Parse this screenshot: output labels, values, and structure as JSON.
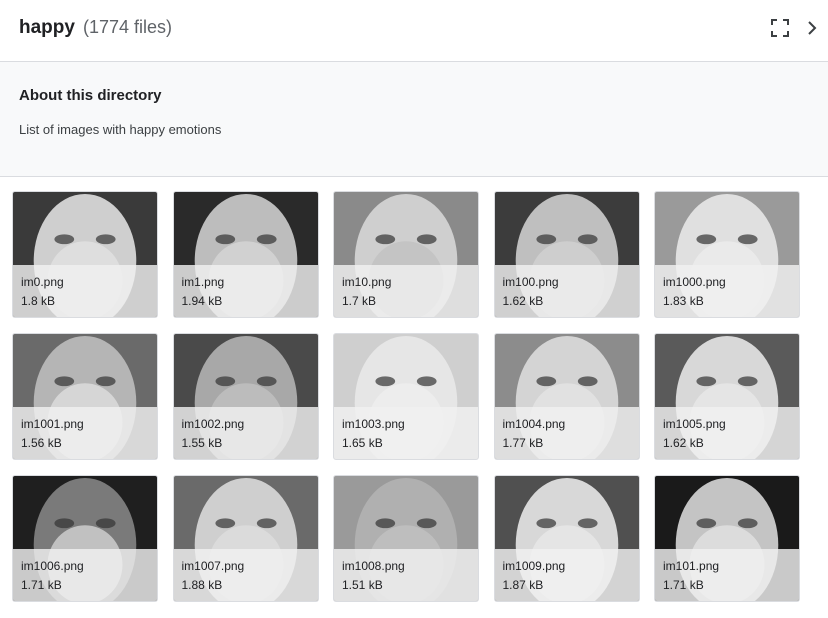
{
  "header": {
    "folder_name": "happy",
    "file_count": "(1774 files)",
    "icons": [
      "fullscreen-icon",
      "chevron-right-icon"
    ]
  },
  "about": {
    "title": "About this directory",
    "description": "List of images with happy emotions"
  },
  "files": [
    {
      "name": "im0.png",
      "size": "1.8 kB"
    },
    {
      "name": "im1.png",
      "size": "1.94 kB"
    },
    {
      "name": "im10.png",
      "size": "1.7 kB"
    },
    {
      "name": "im100.png",
      "size": "1.62 kB"
    },
    {
      "name": "im1000.png",
      "size": "1.83 kB"
    },
    {
      "name": "im1001.png",
      "size": "1.56 kB"
    },
    {
      "name": "im1002.png",
      "size": "1.55 kB"
    },
    {
      "name": "im1003.png",
      "size": "1.65 kB"
    },
    {
      "name": "im1004.png",
      "size": "1.77 kB"
    },
    {
      "name": "im1005.png",
      "size": "1.62 kB"
    },
    {
      "name": "im1006.png",
      "size": "1.71 kB"
    },
    {
      "name": "im1007.png",
      "size": "1.88 kB"
    },
    {
      "name": "im1008.png",
      "size": "1.51 kB"
    },
    {
      "name": "im1009.png",
      "size": "1.87 kB"
    },
    {
      "name": "im101.png",
      "size": "1.71 kB"
    }
  ]
}
